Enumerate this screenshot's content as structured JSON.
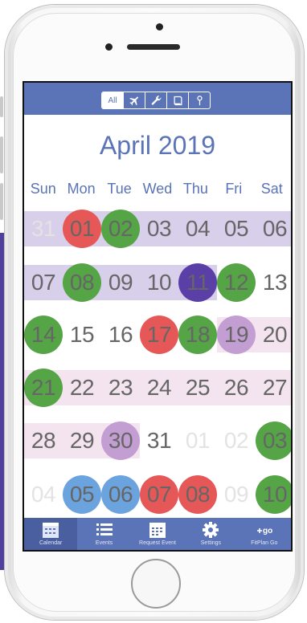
{
  "filters": [
    {
      "label": "All",
      "icon": "all",
      "active": true
    },
    {
      "label": "",
      "icon": "airplane-icon",
      "active": false
    },
    {
      "label": "",
      "icon": "wrench-icon",
      "active": false
    },
    {
      "label": "",
      "icon": "book-icon",
      "active": false
    },
    {
      "label": "",
      "icon": "pin-icon",
      "active": false
    }
  ],
  "calendar": {
    "title": "April 2019",
    "weekdays": [
      "Sun",
      "Mon",
      "Tue",
      "Wed",
      "Thu",
      "Fri",
      "Sat"
    ],
    "weeks": [
      {
        "band": "purple",
        "days": [
          {
            "n": "31",
            "muted": true,
            "mark": ""
          },
          {
            "n": "01",
            "muted": false,
            "mark": "red"
          },
          {
            "n": "02",
            "muted": false,
            "mark": "green"
          },
          {
            "n": "03",
            "muted": false,
            "mark": ""
          },
          {
            "n": "04",
            "muted": false,
            "mark": ""
          },
          {
            "n": "05",
            "muted": false,
            "mark": ""
          },
          {
            "n": "06",
            "muted": false,
            "mark": ""
          }
        ]
      },
      {
        "band": "purple-partial",
        "days": [
          {
            "n": "07",
            "muted": false,
            "mark": ""
          },
          {
            "n": "08",
            "muted": false,
            "mark": "green"
          },
          {
            "n": "09",
            "muted": false,
            "mark": ""
          },
          {
            "n": "10",
            "muted": false,
            "mark": ""
          },
          {
            "n": "11",
            "muted": false,
            "mark": "violet"
          },
          {
            "n": "12",
            "muted": false,
            "mark": "green"
          },
          {
            "n": "13",
            "muted": false,
            "mark": ""
          }
        ]
      },
      {
        "band": "pink-partial",
        "days": [
          {
            "n": "14",
            "muted": false,
            "mark": "green"
          },
          {
            "n": "15",
            "muted": false,
            "mark": ""
          },
          {
            "n": "16",
            "muted": false,
            "mark": ""
          },
          {
            "n": "17",
            "muted": false,
            "mark": "red"
          },
          {
            "n": "18",
            "muted": false,
            "mark": "green"
          },
          {
            "n": "19",
            "muted": false,
            "mark": "lilac"
          },
          {
            "n": "20",
            "muted": false,
            "mark": ""
          }
        ]
      },
      {
        "band": "pink",
        "days": [
          {
            "n": "21",
            "muted": false,
            "mark": "green"
          },
          {
            "n": "22",
            "muted": false,
            "mark": ""
          },
          {
            "n": "23",
            "muted": false,
            "mark": ""
          },
          {
            "n": "24",
            "muted": false,
            "mark": ""
          },
          {
            "n": "25",
            "muted": false,
            "mark": ""
          },
          {
            "n": "26",
            "muted": false,
            "mark": ""
          },
          {
            "n": "27",
            "muted": false,
            "mark": ""
          }
        ]
      },
      {
        "band": "pink-short",
        "days": [
          {
            "n": "28",
            "muted": false,
            "mark": ""
          },
          {
            "n": "29",
            "muted": false,
            "mark": ""
          },
          {
            "n": "30",
            "muted": false,
            "mark": "lilac"
          },
          {
            "n": "31",
            "muted": false,
            "mark": ""
          },
          {
            "n": "01",
            "muted": true,
            "mark": ""
          },
          {
            "n": "02",
            "muted": true,
            "mark": ""
          },
          {
            "n": "03",
            "muted": false,
            "mark": "green"
          }
        ]
      },
      {
        "band": "none",
        "days": [
          {
            "n": "04",
            "muted": true,
            "mark": ""
          },
          {
            "n": "05",
            "muted": false,
            "mark": "blue"
          },
          {
            "n": "06",
            "muted": false,
            "mark": "blue"
          },
          {
            "n": "07",
            "muted": false,
            "mark": "red"
          },
          {
            "n": "08",
            "muted": false,
            "mark": "red"
          },
          {
            "n": "09",
            "muted": true,
            "mark": ""
          },
          {
            "n": "10",
            "muted": false,
            "mark": "green"
          }
        ]
      }
    ]
  },
  "tabs": [
    {
      "label": "Calendar",
      "icon": "calendar-icon",
      "active": true
    },
    {
      "label": "Events",
      "icon": "list-icon",
      "active": false
    },
    {
      "label": "Request Event",
      "icon": "calendar-plus-icon",
      "active": false
    },
    {
      "label": "Settings",
      "icon": "gear-icon",
      "active": false
    },
    {
      "label": "FitPlan Go",
      "icon": "fitplan-go-icon",
      "active": false
    }
  ],
  "colors": {
    "accent": "#5b73b7",
    "red": "#e65757",
    "green": "#55a446",
    "violet": "#5a3fa6",
    "lilac": "#c39ed2",
    "blue": "#6aa3de",
    "band_purple": "#d8cfea",
    "band_pink": "#f3e4f0"
  }
}
